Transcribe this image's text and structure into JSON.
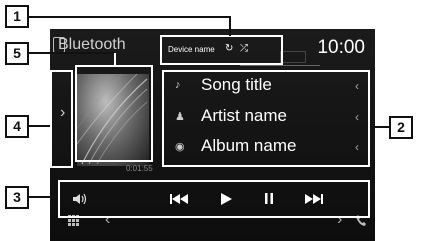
{
  "header": {
    "source_title": "Bluetooth",
    "clock": "10:00"
  },
  "device_bar": {
    "device_name": "Device name",
    "repeat_icon": "repeat-icon",
    "shuffle_icon": "shuffle-icon"
  },
  "track": {
    "title": "Song title",
    "artist": "Artist name",
    "album": "Album name",
    "elapsed": "0:01:55"
  },
  "controls": {
    "mute_icon": "speaker-icon",
    "prev_icon": "skip-previous-icon",
    "play_icon": "play-icon",
    "pause_icon": "pause-icon",
    "next_icon": "skip-next-icon"
  },
  "bottom_bar": {
    "menu_icon": "grid-icon",
    "left_arrow": "‹",
    "right_arrow": "›",
    "phone_icon": "phone-icon"
  },
  "callouts": [
    "1",
    "2",
    "3",
    "4",
    "5"
  ],
  "colors": {
    "screen_bg": "#111111",
    "text": "#ffffff",
    "callout_border": "#111111"
  }
}
